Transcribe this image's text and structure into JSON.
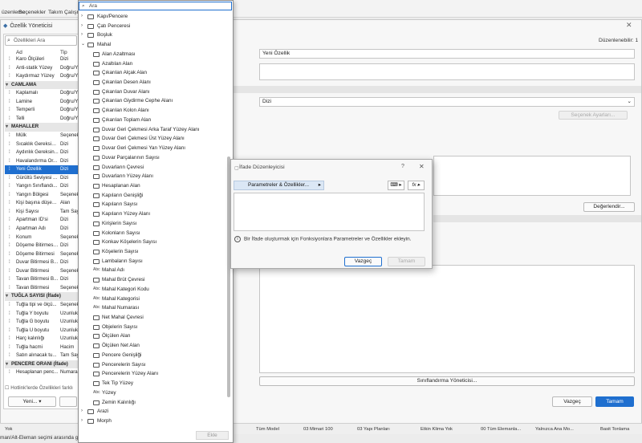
{
  "menubar": {
    "items": [
      "üzenleme",
      "Seçenekler",
      "Takım Çalışm"
    ]
  },
  "window": {
    "title": "Özellik Yöneticisi",
    "close": "✕",
    "editable_label": "Düzenlenebilir: 1"
  },
  "left": {
    "search_placeholder": "Özellikleri Ara",
    "col_name": "Ad",
    "col_type": "Tip",
    "rows": [
      {
        "name": "Karo Ölçüleri",
        "type": "Dizi",
        "kind": "item"
      },
      {
        "name": "Anti-statik Yüzey",
        "type": "Doğru/Y",
        "kind": "item"
      },
      {
        "name": "Kaydırmaz Yüzey",
        "type": "Doğru/Y",
        "kind": "item"
      },
      {
        "name": "CAMLAMA",
        "type": "",
        "kind": "group"
      },
      {
        "name": "Kaplamalı",
        "type": "Doğru/Y",
        "kind": "item"
      },
      {
        "name": "Lamine",
        "type": "Doğru/Y",
        "kind": "item"
      },
      {
        "name": "Temperli",
        "type": "Doğru/Y",
        "kind": "item"
      },
      {
        "name": "Telli",
        "type": "Doğru/Y",
        "kind": "item"
      },
      {
        "name": "MAHALLER",
        "type": "",
        "kind": "group"
      },
      {
        "name": "Mülk",
        "type": "Seçenek",
        "kind": "item"
      },
      {
        "name": "Sıcaklık Gereksini...",
        "type": "Dizi",
        "kind": "item"
      },
      {
        "name": "Aydınlık Gereksin...",
        "type": "Dizi",
        "kind": "item"
      },
      {
        "name": "Havalandırma Or...",
        "type": "Dizi",
        "kind": "item"
      },
      {
        "name": "Yeni Özellik",
        "type": "Dizi",
        "kind": "selected"
      },
      {
        "name": "Gürültü Seviyesi ...",
        "type": "Dizi",
        "kind": "item"
      },
      {
        "name": "Yangın Sınıflandı...",
        "type": "Dizi",
        "kind": "item"
      },
      {
        "name": "Yangın Bölgesi",
        "type": "Seçenek",
        "kind": "item"
      },
      {
        "name": "Kişi başına düşen...",
        "type": "Alan",
        "kind": "item"
      },
      {
        "name": "Kişi Sayısı",
        "type": "Tam Say",
        "kind": "item"
      },
      {
        "name": "Apartman ID'si",
        "type": "Dizi",
        "kind": "item"
      },
      {
        "name": "Apartman Adı",
        "type": "Dizi",
        "kind": "item"
      },
      {
        "name": "Konum",
        "type": "Seçenek",
        "kind": "item"
      },
      {
        "name": "Döşeme Bitirmesi ...",
        "type": "Dizi",
        "kind": "item"
      },
      {
        "name": "Döşeme Bitirmesi",
        "type": "Seçenek",
        "kind": "item"
      },
      {
        "name": "Duvar Bitirmesi B...",
        "type": "Dizi",
        "kind": "item"
      },
      {
        "name": "Duvar Bitirmesi",
        "type": "Seçenek",
        "kind": "item"
      },
      {
        "name": "Tavan Bitirmesi B...",
        "type": "Dizi",
        "kind": "item"
      },
      {
        "name": "Tavan Bitirmesi",
        "type": "Seçenek",
        "kind": "item"
      },
      {
        "name": "TUĞLA SAYISI (İfade)",
        "type": "",
        "kind": "group"
      },
      {
        "name": "Tuğla tipi ve ölçü...",
        "type": "Seçenek",
        "kind": "item"
      },
      {
        "name": "Tuğla Y boyutu",
        "type": "Uzunluk",
        "kind": "item"
      },
      {
        "name": "Tuğla G boyutu",
        "type": "Uzunluk",
        "kind": "item"
      },
      {
        "name": "Tuğla U boyutu",
        "type": "Uzunluk",
        "kind": "item"
      },
      {
        "name": "Harç kalınlığı",
        "type": "Uzunluk",
        "kind": "item"
      },
      {
        "name": "Tuğla hacmi",
        "type": "Hacim",
        "kind": "item"
      },
      {
        "name": "Satın alınacak tu...",
        "type": "Tam Say",
        "kind": "item"
      },
      {
        "name": "PENCERE ORANI (İfade)",
        "type": "",
        "kind": "group"
      },
      {
        "name": "Hesaplanan penc...",
        "type": "Numara",
        "kind": "item"
      }
    ],
    "hotlink_label": "Hotlink'lerde Özellikleri farklı",
    "new_button": "Yeni..."
  },
  "right": {
    "name_value": "Yeni Özellik",
    "type_value": "Dizi",
    "options_button": "Seçenek Ayarları...",
    "values_button": "Değerlendir...",
    "classification_button": "Sınıflandırma Yöneticisi...",
    "cancel": "Vazgeç",
    "ok": "Tamam"
  },
  "dropdown": {
    "search_placeholder": "Ara",
    "items": [
      {
        "label": "Kapı/Pencere",
        "level": 0,
        "chev": "›",
        "icon": "box"
      },
      {
        "label": "Çatı Penceresi",
        "level": 0,
        "chev": "›",
        "icon": "box"
      },
      {
        "label": "Boşluk",
        "level": 0,
        "chev": "›",
        "icon": "box"
      },
      {
        "label": "Mahal",
        "level": 0,
        "chev": "⌄",
        "icon": "box"
      },
      {
        "label": "Alan Azaltması",
        "level": 1,
        "chev": "",
        "icon": "box"
      },
      {
        "label": "Azaltılan Alan",
        "level": 1,
        "chev": "",
        "icon": "box"
      },
      {
        "label": "Çıkarılan Alçak Alan",
        "level": 1,
        "chev": "",
        "icon": "box"
      },
      {
        "label": "Çıkarılan Desen Alanı",
        "level": 1,
        "chev": "",
        "icon": "box"
      },
      {
        "label": "Çıkarılan Duvar Alanı",
        "level": 1,
        "chev": "",
        "icon": "box"
      },
      {
        "label": "Çıkarılan Giydirme Cephe Alanı",
        "level": 1,
        "chev": "",
        "icon": "box"
      },
      {
        "label": "Çıkarılan Kolon Alanı",
        "level": 1,
        "chev": "",
        "icon": "box"
      },
      {
        "label": "Çıkarılan Toplam Alan",
        "level": 1,
        "chev": "",
        "icon": "box"
      },
      {
        "label": "Duvar Geri Çekmesi Arka Taraf Yüzey Alanı",
        "level": 1,
        "chev": "",
        "icon": "box"
      },
      {
        "label": "Duvar Geri Çekmesi Üst Yüzey Alanı",
        "level": 1,
        "chev": "",
        "icon": "box"
      },
      {
        "label": "Duvar Geri Çekmesi Yan Yüzey Alanı",
        "level": 1,
        "chev": "",
        "icon": "box"
      },
      {
        "label": "Duvar Parçalarının Sayısı",
        "level": 1,
        "chev": "",
        "icon": "box"
      },
      {
        "label": "Duvarların Çevresi",
        "level": 1,
        "chev": "",
        "icon": "box"
      },
      {
        "label": "Duvarların Yüzey Alanı",
        "level": 1,
        "chev": "",
        "icon": "box"
      },
      {
        "label": "Hesaplanan Alan",
        "level": 1,
        "chev": "",
        "icon": "box"
      },
      {
        "label": "Kapıların Genişliği",
        "level": 1,
        "chev": "",
        "icon": "box"
      },
      {
        "label": "Kapıların Sayısı",
        "level": 1,
        "chev": "",
        "icon": "box"
      },
      {
        "label": "Kapıların Yüzey Alanı",
        "level": 1,
        "chev": "",
        "icon": "box"
      },
      {
        "label": "Kirişlerin Sayısı",
        "level": 1,
        "chev": "",
        "icon": "box"
      },
      {
        "label": "Kolonların Sayısı",
        "level": 1,
        "chev": "",
        "icon": "box"
      },
      {
        "label": "Konkav Köşelerin Sayısı",
        "level": 1,
        "chev": "",
        "icon": "box"
      },
      {
        "label": "Köşelerin Sayısı",
        "level": 1,
        "chev": "",
        "icon": "box"
      },
      {
        "label": "Lambaların Sayısı",
        "level": 1,
        "chev": "",
        "icon": "box"
      },
      {
        "label": "Mahal Adı",
        "level": 1,
        "chev": "",
        "icon": "txt"
      },
      {
        "label": "Mahal Brüt Çevresi",
        "level": 1,
        "chev": "",
        "icon": "box"
      },
      {
        "label": "Mahal Kategori Kodu",
        "level": 1,
        "chev": "",
        "icon": "txt"
      },
      {
        "label": "Mahal Kategorisi",
        "level": 1,
        "chev": "",
        "icon": "txt"
      },
      {
        "label": "Mahal Numarası",
        "level": 1,
        "chev": "",
        "icon": "txt"
      },
      {
        "label": "Net Mahal Çevresi",
        "level": 1,
        "chev": "",
        "icon": "box"
      },
      {
        "label": "Objelerin Sayısı",
        "level": 1,
        "chev": "",
        "icon": "box"
      },
      {
        "label": "Ölçülen Alan",
        "level": 1,
        "chev": "",
        "icon": "box"
      },
      {
        "label": "Ölçülen Net Alan",
        "level": 1,
        "chev": "",
        "icon": "box"
      },
      {
        "label": "Pencere Genişliği",
        "level": 1,
        "chev": "",
        "icon": "box"
      },
      {
        "label": "Pencerelerin Sayısı",
        "level": 1,
        "chev": "",
        "icon": "box"
      },
      {
        "label": "Pencerelerin Yüzey Alanı",
        "level": 1,
        "chev": "",
        "icon": "box"
      },
      {
        "label": "Tek Tip Yüzey",
        "level": 1,
        "chev": "",
        "icon": "box"
      },
      {
        "label": "Yüzey",
        "level": 1,
        "chev": "",
        "icon": "txt"
      },
      {
        "label": "Zemin Kalınlığı",
        "level": 1,
        "chev": "",
        "icon": "box"
      },
      {
        "label": "Arazi",
        "level": 0,
        "chev": "›",
        "icon": "box"
      },
      {
        "label": "Morph",
        "level": 0,
        "chev": "›",
        "icon": "box"
      }
    ],
    "icon_txt_glyph": "Abc",
    "add_button": "Ekle"
  },
  "dialog": {
    "title": "İfade Düzenleyicisi",
    "help": "?",
    "close": "✕",
    "params_button": "Parametreler & Özellikler...",
    "arrow": "▸",
    "tool2": "⌨ ▸",
    "tool3": "fx ▸",
    "info": "Bir İfade oluşturmak için Fonksiyonlara Parametreler ve Özellikler ekleyin.",
    "info_glyph": "i",
    "cancel": "Vazgeç",
    "ok": "Tamam"
  },
  "statusbar": {
    "items": [
      "Yok",
      "Tüm Model",
      "03 Mimari 100",
      "03 Yapı Planları",
      "Etkin Klima Yok",
      "00 Tüm Elemanla...",
      "Yalnızca Ana Mo...",
      "Basit Tonlama"
    ]
  },
  "footer_text": "man/Alt-Eleman seçimi arasında g"
}
